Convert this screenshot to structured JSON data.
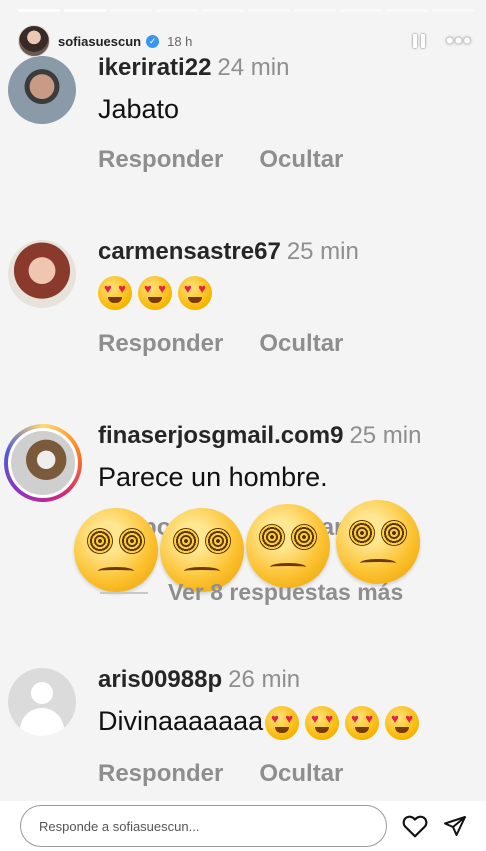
{
  "story": {
    "author": "sofiasuescun",
    "age": "18 h",
    "progress": {
      "total_segments": 10,
      "completed_segments": 2
    }
  },
  "comments": [
    {
      "username": "ikerirati22",
      "time": "24 min",
      "text": "Jabato",
      "reply": "Responder",
      "hide": "Ocultar"
    },
    {
      "username": "carmensastre67",
      "time": "25 min",
      "text": "",
      "emojis": 3,
      "reply": "Responder",
      "hide": "Ocultar"
    },
    {
      "username": "finaserjosgmail.com9",
      "time": "25 min",
      "text": "Parece un hombre.",
      "reply": "Responder",
      "hide": "Ocultar"
    },
    {
      "username": "aris00988p",
      "time": "26 min",
      "text": "Divinaaaaaaa",
      "emojis": 4,
      "reply": "Responder",
      "hide": "Ocultar"
    }
  ],
  "view_more": "Ver 8 respuestas más",
  "sticker": {
    "emoji": "face-with-spiral-eyes",
    "count": 4
  },
  "footer": {
    "reply_placeholder": "Responde a sofiasuescun...",
    "like_icon": "heart-icon",
    "send_icon": "send-icon"
  },
  "colors": {
    "muted": "#8e8e8e",
    "verified": "#3897f0",
    "story_ring": "#d62976"
  }
}
